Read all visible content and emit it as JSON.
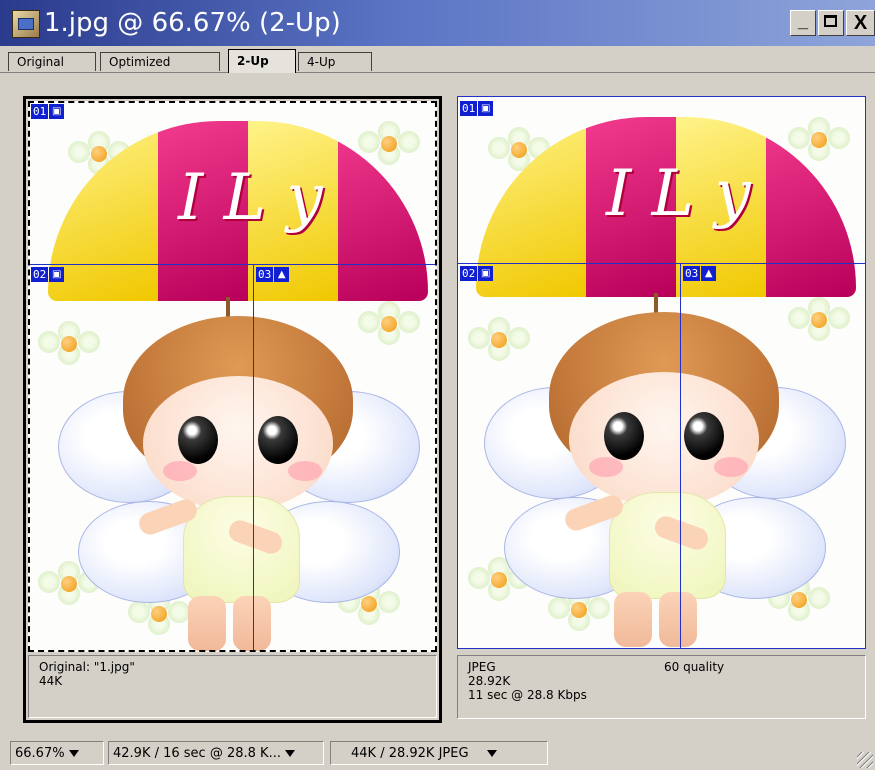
{
  "window": {
    "title": "1.jpg @ 66.67% (2-Up)",
    "controls": {
      "minimize": "_",
      "maximize": "□",
      "close": "X"
    }
  },
  "tabs": [
    {
      "label": "Original",
      "active": false
    },
    {
      "label": "Optimized",
      "active": false
    },
    {
      "label": "2-Up",
      "active": true
    },
    {
      "label": "4-Up",
      "active": false
    }
  ],
  "panels": {
    "left": {
      "slices": [
        {
          "number": "01",
          "icon": "slice-auto-icon"
        },
        {
          "number": "02",
          "icon": "slice-auto-icon"
        },
        {
          "number": "03",
          "icon": "slice-image-icon"
        }
      ],
      "info": {
        "line1": "Original: \"1.jpg\"",
        "line2": "44K"
      }
    },
    "right": {
      "slices": [
        {
          "number": "01",
          "icon": "slice-auto-icon"
        },
        {
          "number": "02",
          "icon": "slice-auto-icon"
        },
        {
          "number": "03",
          "icon": "slice-image-icon"
        }
      ],
      "info": {
        "format": "JPEG",
        "quality": "60 quality",
        "size": "28.92K",
        "time": "11 sec @ 28.8 Kbps"
      }
    }
  },
  "statusbar": {
    "zoom": "66.67%",
    "download": "42.9K / 16 sec @ 28.8 K...",
    "size_compare": "44K / 28.92K JPEG"
  },
  "colors": {
    "title_gradient_start": "#2a3a8c",
    "title_gradient_end": "#8ea4da",
    "slice_blue": "#1020d0",
    "chrome": "#d4d0c8"
  }
}
